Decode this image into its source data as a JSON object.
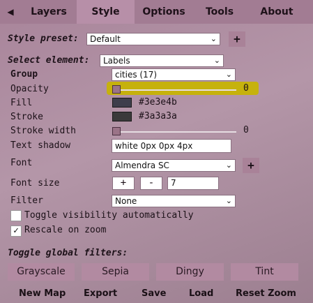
{
  "topbar": {
    "collapse_icon": "◀",
    "tabs": [
      "Layers",
      "Style",
      "Options",
      "Tools",
      "About"
    ],
    "active_tab": "Style"
  },
  "style_preset": {
    "label": "Style preset:",
    "value": "Default",
    "add_icon": "+"
  },
  "select_element": {
    "label": "Select element:",
    "value": "Labels"
  },
  "group": {
    "label": "Group",
    "value": "cities (17)"
  },
  "opacity": {
    "label": "Opacity",
    "value": "0",
    "level": 0
  },
  "fill": {
    "label": "Fill",
    "color": "#3e3e4b",
    "value": "#3e3e4b"
  },
  "stroke": {
    "label": "Stroke",
    "color": "#3a3a3a",
    "value": "#3a3a3a"
  },
  "stroke_width": {
    "label": "Stroke width",
    "value": "0",
    "level": 0
  },
  "text_shadow": {
    "label": "Text shadow",
    "value": "white 0px 0px 4px"
  },
  "font": {
    "label": "Font",
    "value": "Almendra SC",
    "add_icon": "+"
  },
  "font_size": {
    "label": "Font size",
    "plus": "+",
    "minus": "-",
    "value": "7"
  },
  "filter": {
    "label": "Filter",
    "value": "None"
  },
  "toggle_visibility": {
    "label": "Toggle visibility automatically",
    "checked": false
  },
  "rescale_on_zoom": {
    "label": "Rescale on zoom",
    "checked": true,
    "check_glyph": "✓"
  },
  "global_filters": {
    "label": "Toggle global filters:",
    "buttons": [
      "Grayscale",
      "Sepia",
      "Dingy",
      "Tint"
    ]
  },
  "bottombar": {
    "buttons": [
      "New Map",
      "Export",
      "Save",
      "Load",
      "Reset Zoom"
    ]
  },
  "colors": {
    "accent_highlight": "#c8b400",
    "tab_active": "#b78fa8",
    "panel": "#a27c93"
  }
}
